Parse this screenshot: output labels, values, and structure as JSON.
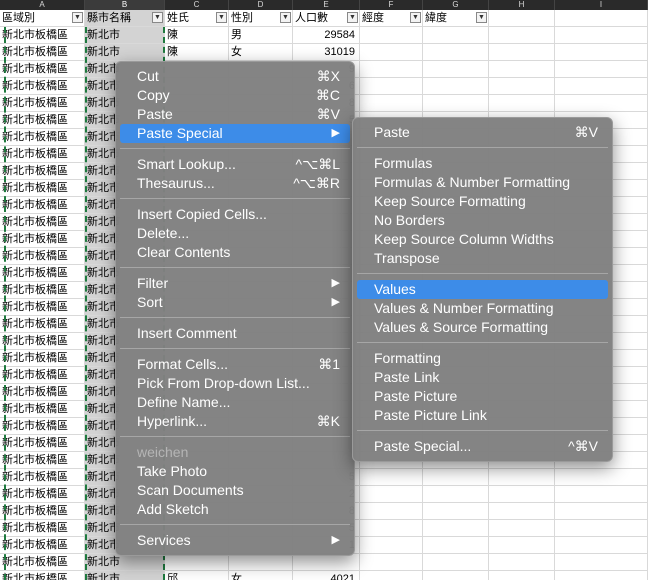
{
  "columns": [
    {
      "letter": "A",
      "header": "區域別",
      "filter": true
    },
    {
      "letter": "B",
      "header": "縣市名稱",
      "filter": true
    },
    {
      "letter": "C",
      "header": "姓氏",
      "filter": true
    },
    {
      "letter": "D",
      "header": "性別",
      "filter": true
    },
    {
      "letter": "E",
      "header": "人口數",
      "filter": true
    },
    {
      "letter": "F",
      "header": "經度",
      "filter": true
    },
    {
      "letter": "G",
      "header": "緯度",
      "filter": true
    },
    {
      "letter": "H",
      "header": "",
      "filter": false
    },
    {
      "letter": "I",
      "header": "",
      "filter": false
    }
  ],
  "filter_glyph": "▼",
  "rows": [
    {
      "a": "新北市板橋區",
      "b": "新北市",
      "c": "陳",
      "d": "男",
      "e": "29584"
    },
    {
      "a": "新北市板橋區",
      "b": "新北市",
      "c": "陳",
      "d": "女",
      "e": "31019"
    },
    {
      "a": "新北市板橋區",
      "b": "新北市",
      "c": "",
      "d": "",
      "e": "9"
    },
    {
      "a": "新北市板橋區",
      "b": "新北市",
      "c": "",
      "d": "",
      "e": "6"
    },
    {
      "a": "新北市板橋區",
      "b": "新北市",
      "c": "",
      "d": "",
      "e": "8"
    },
    {
      "a": "新北市板橋區",
      "b": "新北市",
      "c": "",
      "d": "",
      "e": "5"
    },
    {
      "a": "新北市板橋區",
      "b": "新北市",
      "c": "",
      "d": "",
      "e": ""
    },
    {
      "a": "新北市板橋區",
      "b": "新北市",
      "c": "",
      "d": "",
      "e": ""
    },
    {
      "a": "新北市板橋區",
      "b": "新北市",
      "c": "",
      "d": "",
      "e": ""
    },
    {
      "a": "新北市板橋區",
      "b": "新北市",
      "c": "",
      "d": "",
      "e": ""
    },
    {
      "a": "新北市板橋區",
      "b": "新北市",
      "c": "",
      "d": "",
      "e": ""
    },
    {
      "a": "新北市板橋區",
      "b": "新北市",
      "c": "",
      "d": "",
      "e": ""
    },
    {
      "a": "新北市板橋區",
      "b": "新北市",
      "c": "",
      "d": "",
      "e": ""
    },
    {
      "a": "新北市板橋區",
      "b": "新北市",
      "c": "",
      "d": "",
      "e": ""
    },
    {
      "a": "新北市板橋區",
      "b": "新北市",
      "c": "",
      "d": "",
      "e": ""
    },
    {
      "a": "新北市板橋區",
      "b": "新北市",
      "c": "",
      "d": "",
      "e": ""
    },
    {
      "a": "新北市板橋區",
      "b": "新北市",
      "c": "",
      "d": "",
      "e": ""
    },
    {
      "a": "新北市板橋區",
      "b": "新北市",
      "c": "",
      "d": "",
      "e": ""
    },
    {
      "a": "新北市板橋區",
      "b": "新北市",
      "c": "",
      "d": "",
      "e": ""
    },
    {
      "a": "新北市板橋區",
      "b": "新北市",
      "c": "",
      "d": "",
      "e": ""
    },
    {
      "a": "新北市板橋區",
      "b": "新北市",
      "c": "",
      "d": "",
      "e": ""
    },
    {
      "a": "新北市板橋區",
      "b": "新北市",
      "c": "",
      "d": "",
      "e": ""
    },
    {
      "a": "新北市板橋區",
      "b": "新北市",
      "c": "",
      "d": "",
      "e": ""
    },
    {
      "a": "新北市板橋區",
      "b": "新北市",
      "c": "",
      "d": "",
      "e": ""
    },
    {
      "a": "新北市板橋區",
      "b": "新北市",
      "c": "",
      "d": "",
      "e": ""
    },
    {
      "a": "新北市板橋區",
      "b": "新北市",
      "c": "",
      "d": "",
      "e": ""
    },
    {
      "a": "新北市板橋區",
      "b": "新北市",
      "c": "",
      "d": "",
      "e": "5"
    },
    {
      "a": "新北市板橋區",
      "b": "新北市",
      "c": "",
      "d": "",
      "e": "2"
    },
    {
      "a": "新北市板橋區",
      "b": "新北市",
      "c": "",
      "d": "",
      "e": "8"
    },
    {
      "a": "新北市板橋區",
      "b": "新北市",
      "c": "",
      "d": "",
      "e": "5"
    },
    {
      "a": "新北市板橋區",
      "b": "新北市",
      "c": "",
      "d": "",
      "e": "1"
    },
    {
      "a": "新北市板橋區",
      "b": "新北市",
      "c": "",
      "d": "",
      "e": ""
    },
    {
      "a": "新北市板橋區",
      "b": "新北市",
      "c": "邱",
      "d": "女",
      "e": "4021"
    },
    {
      "a": "新北市板橋區",
      "b": "新北市",
      "c": "周",
      "d": "男",
      "e": "3524"
    }
  ],
  "context_menu": {
    "items": [
      {
        "label": "Cut",
        "shortcut": "⌘X"
      },
      {
        "label": "Copy",
        "shortcut": "⌘C"
      },
      {
        "label": "Paste",
        "shortcut": "⌘V"
      },
      {
        "label": "Paste Special",
        "submenu": true,
        "highlighted": true
      },
      {
        "sep": true
      },
      {
        "label": "Smart Lookup...",
        "shortcut": "^⌥⌘L"
      },
      {
        "label": "Thesaurus...",
        "shortcut": "^⌥⌘R"
      },
      {
        "sep": true
      },
      {
        "label": "Insert Copied Cells..."
      },
      {
        "label": "Delete..."
      },
      {
        "label": "Clear Contents"
      },
      {
        "sep": true
      },
      {
        "label": "Filter",
        "submenu": true
      },
      {
        "label": "Sort",
        "submenu": true
      },
      {
        "sep": true
      },
      {
        "label": "Insert Comment"
      },
      {
        "sep": true
      },
      {
        "label": "Format Cells...",
        "shortcut": "⌘1"
      },
      {
        "label": "Pick From Drop-down List..."
      },
      {
        "label": "Define Name..."
      },
      {
        "label": "Hyperlink...",
        "shortcut": "⌘K"
      },
      {
        "sep": true
      },
      {
        "label": "weichen",
        "disabled": true
      },
      {
        "label": "Take Photo"
      },
      {
        "label": "Scan Documents"
      },
      {
        "label": "Add Sketch"
      },
      {
        "sep": true
      },
      {
        "label": "Services",
        "submenu": true
      }
    ]
  },
  "paste_special_menu": {
    "items": [
      {
        "label": "Paste",
        "shortcut": "⌘V"
      },
      {
        "sep": true
      },
      {
        "label": "Formulas"
      },
      {
        "label": "Formulas & Number Formatting"
      },
      {
        "label": "Keep Source Formatting"
      },
      {
        "label": "No Borders"
      },
      {
        "label": "Keep Source Column Widths"
      },
      {
        "label": "Transpose"
      },
      {
        "sep": true
      },
      {
        "label": "Values",
        "highlighted": true
      },
      {
        "label": "Values & Number Formatting"
      },
      {
        "label": "Values & Source Formatting"
      },
      {
        "sep": true
      },
      {
        "label": "Formatting"
      },
      {
        "label": "Paste Link"
      },
      {
        "label": "Paste Picture"
      },
      {
        "label": "Paste Picture Link"
      },
      {
        "sep": true
      },
      {
        "label": "Paste Special...",
        "shortcut": "^⌘V"
      }
    ]
  },
  "arrow_glyph": "▶",
  "colors": {
    "highlight": "#3d8ce8",
    "menu_bg": "#808080",
    "copy_marquee": "#1f7a3f"
  }
}
